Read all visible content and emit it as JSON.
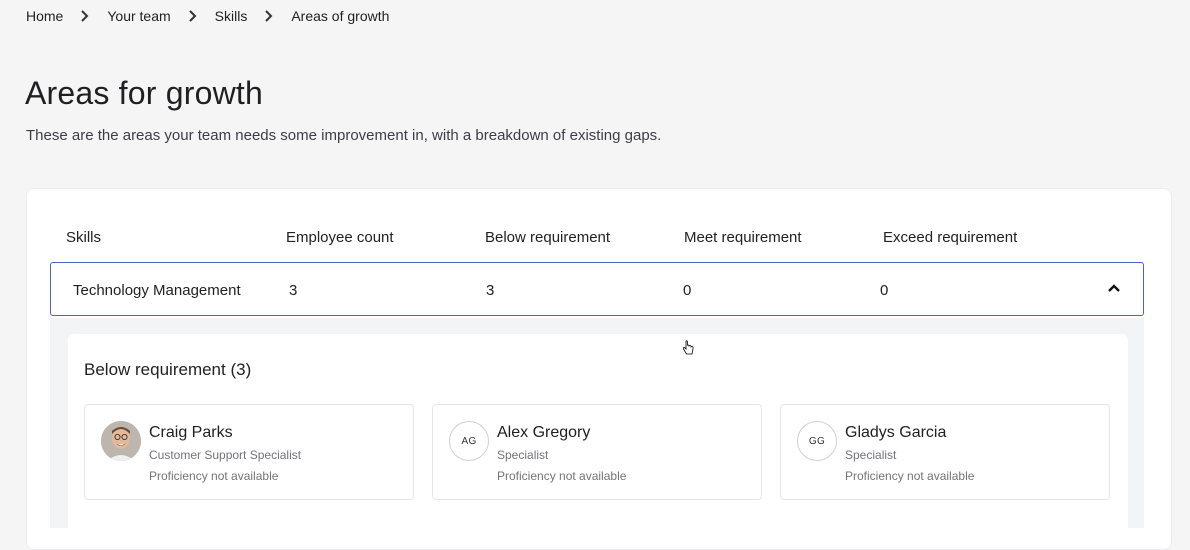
{
  "breadcrumb": [
    "Home",
    "Your team",
    "Skills",
    "Areas of growth"
  ],
  "page": {
    "title": "Areas for growth",
    "subtitle": "These are the areas your team needs some improvement in, with a breakdown of existing gaps."
  },
  "table": {
    "headers": [
      "Skills",
      "Employee count",
      "Below requirement",
      "Meet requirement",
      "Exceed requirement"
    ],
    "rows": [
      {
        "skill": "Technology Management",
        "employee_count": "3",
        "below": "3",
        "meet": "0",
        "exceed": "0"
      }
    ]
  },
  "detail": {
    "section_title": "Below requirement (3)",
    "people": [
      {
        "name": "Craig Parks",
        "role": "Customer Support Specialist",
        "proficiency": "Proficiency not available",
        "initials": ""
      },
      {
        "name": "Alex Gregory",
        "role": "Specialist",
        "proficiency": "Proficiency not available",
        "initials": "AG"
      },
      {
        "name": "Gladys Garcia",
        "role": "Specialist",
        "proficiency": "Proficiency not available",
        "initials": "GG"
      }
    ]
  },
  "icons": {
    "separator": "chevron-right-icon",
    "row_toggle": "chevron-up-icon",
    "cursor": "hand-cursor-icon"
  },
  "colors": {
    "row_border": "#4a65c7",
    "background": "#f5f5f6"
  }
}
